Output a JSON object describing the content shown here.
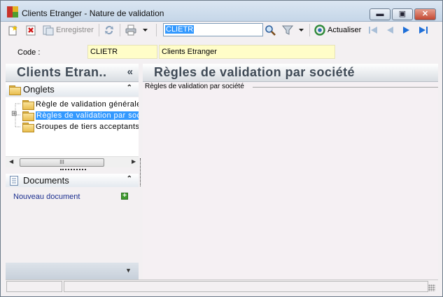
{
  "window": {
    "title": "Clients Etranger -  Nature de validation",
    "minimize_symbol": "▬",
    "maximize_symbol": "▣",
    "close_symbol": "✕"
  },
  "toolbar": {
    "save_label": "Enregistrer",
    "search_value": "CLIETR",
    "refresh_label": "Actualiser",
    "icons": [
      "new-icon",
      "delete-icon",
      "save-icon",
      "sync-icon",
      "print-icon",
      "dropdown-arrow-icon",
      "search-icon",
      "filter-icon",
      "dropdown-arrow-icon",
      "refresh-icon",
      "first-icon",
      "previous-icon",
      "next-icon",
      "last-icon"
    ]
  },
  "code_row": {
    "label": "Code :",
    "code_value": "CLIETR",
    "name_value": "Clients Etranger"
  },
  "left_panel": {
    "header_title": "Clients Etran..",
    "collapse_symbol": "«",
    "onglets": {
      "label": "Onglets",
      "chevron": "⌃",
      "items": [
        {
          "label": "Règle de validation générale",
          "expander": ""
        },
        {
          "label": "Règles de validation par société",
          "expander": "⊞"
        },
        {
          "label": "Groupes de tiers acceptants",
          "expander": ""
        }
      ]
    },
    "scroll_grip": "III",
    "documents": {
      "label": "Documents",
      "chevron": "⌃",
      "new_document": "Nouveau document"
    }
  },
  "right_panel": {
    "header_title": "Règles de validation par société",
    "group_title": "Règles de validation par société"
  },
  "colors": {
    "accent_selection": "#3399ff",
    "field_background": "#fffdc8",
    "panel_header_text": "#3f4a56",
    "link": "#1c2f8f"
  }
}
